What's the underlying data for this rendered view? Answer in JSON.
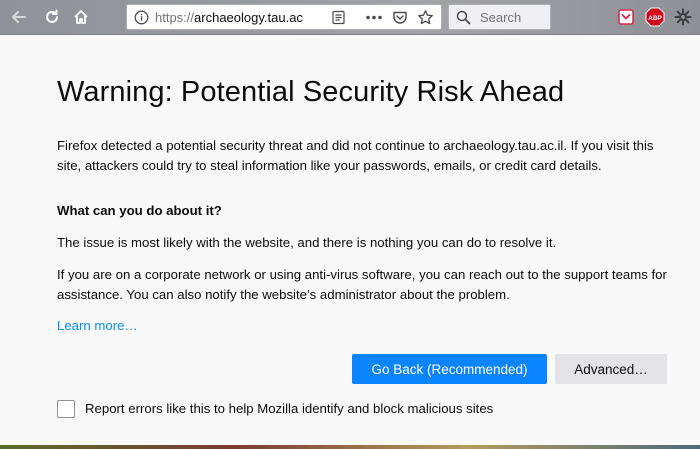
{
  "browser": {
    "url_proto": "https://",
    "url_host": "archaeology.tau.ac",
    "search_placeholder": "Search",
    "addon_abp_label": "ABP"
  },
  "page": {
    "title": "Warning: Potential Security Risk Ahead",
    "intro": "Firefox detected a potential security threat and did not continue to archaeology.tau.ac.il. If you visit this site, attackers could try to steal information like your passwords, emails, or credit card details.",
    "what_heading": "What can you do about it?",
    "issue_text": "The issue is most likely with the website, and there is nothing you can do to resolve it.",
    "corporate_text": "If you are on a corporate network or using anti-virus software, you can reach out to the support teams for assistance. You can also notify the website’s administrator about the problem.",
    "learn_more": "Learn more…",
    "go_back_label": "Go Back (Recommended)",
    "advanced_label": "Advanced…",
    "report_label": "Report errors like this to help Mozilla identify and block malicious sites",
    "report_checked": false
  },
  "colors": {
    "primary_button": "#0a84ff",
    "link": "#0a8dff"
  }
}
